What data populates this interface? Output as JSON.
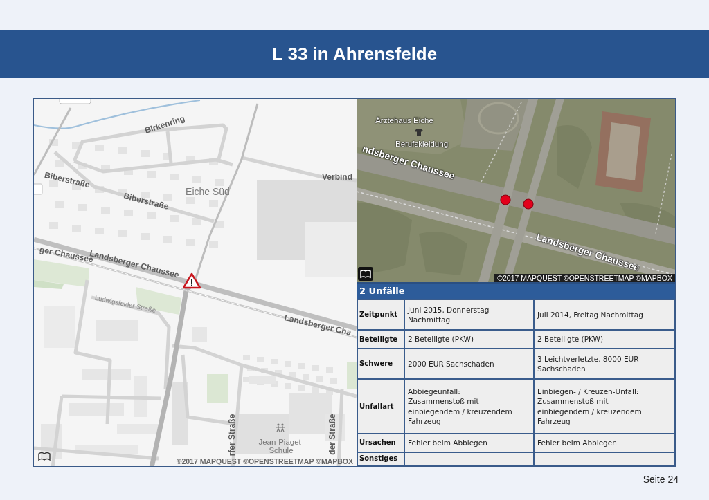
{
  "header": {
    "title": "L 33 in Ahrensfelde"
  },
  "street_map": {
    "labels": [
      {
        "text": "Birkenring",
        "kind": "road"
      },
      {
        "text": "Verbind",
        "kind": "road"
      },
      {
        "text": "Biberstraße",
        "kind": "road"
      },
      {
        "text": "Eiche Süd",
        "kind": "district"
      },
      {
        "text": "Biberstraße",
        "kind": "road"
      },
      {
        "text": "ger Chaussee",
        "kind": "road"
      },
      {
        "text": "Landsberger Chaussee",
        "kind": "road"
      },
      {
        "text": "Ludwigsfelder Straße",
        "kind": "minor_road"
      },
      {
        "text": "Landsberger Cha",
        "kind": "road"
      },
      {
        "text": "rfer Straße",
        "kind": "road"
      },
      {
        "text": "Jean-Piaget-Schule",
        "kind": "poi"
      },
      {
        "text": "der Straße",
        "kind": "road"
      }
    ],
    "attribution": "©2017 MAPQUEST ©OPENSTREETMAP ©MAPBOX"
  },
  "aerial_map": {
    "labels": [
      {
        "text": "Ärztehaus Eiche",
        "kind": "poi"
      },
      {
        "text": "Berufskleidung",
        "kind": "poi"
      },
      {
        "text": "ndsberger Chaussee",
        "kind": "road"
      },
      {
        "text": "Landsberger Chaussee",
        "kind": "road"
      }
    ],
    "attribution": "©2017 MAPQUEST ©OPENSTREETMAP ©MAPBOX"
  },
  "accidents": {
    "title": "2 Unfälle",
    "rows": [
      {
        "label": "Zeitpunkt",
        "values": [
          "Juni 2015, Donnerstag\nNachmittag",
          "Juli 2014, Freitag Nachmittag"
        ]
      },
      {
        "label": "Beteiligte",
        "values": [
          "2 Beteiligte (PKW)",
          "2 Beteiligte (PKW)"
        ]
      },
      {
        "label": "Schwere",
        "values": [
          "2000 EUR Sachschaden",
          "3 Leichtverletzte, 8000 EUR\nSachschaden"
        ]
      },
      {
        "label": "Unfallart",
        "values": [
          "Abbiegeunfall:\nZusammenstoß mit\neinbiegendem / kreuzendem\nFahrzeug",
          "Einbiegen- / Kreuzen-Unfall:\nZusammenstoß mit\neinbiegendem / kreuzendem\nFahrzeug"
        ]
      },
      {
        "label": "Ursachen",
        "values": [
          "Fehler beim Abbiegen",
          "Fehler beim Abbiegen"
        ]
      },
      {
        "label": "Sonstiges"
      }
    ]
  },
  "footer": {
    "page": "Seite 24"
  }
}
